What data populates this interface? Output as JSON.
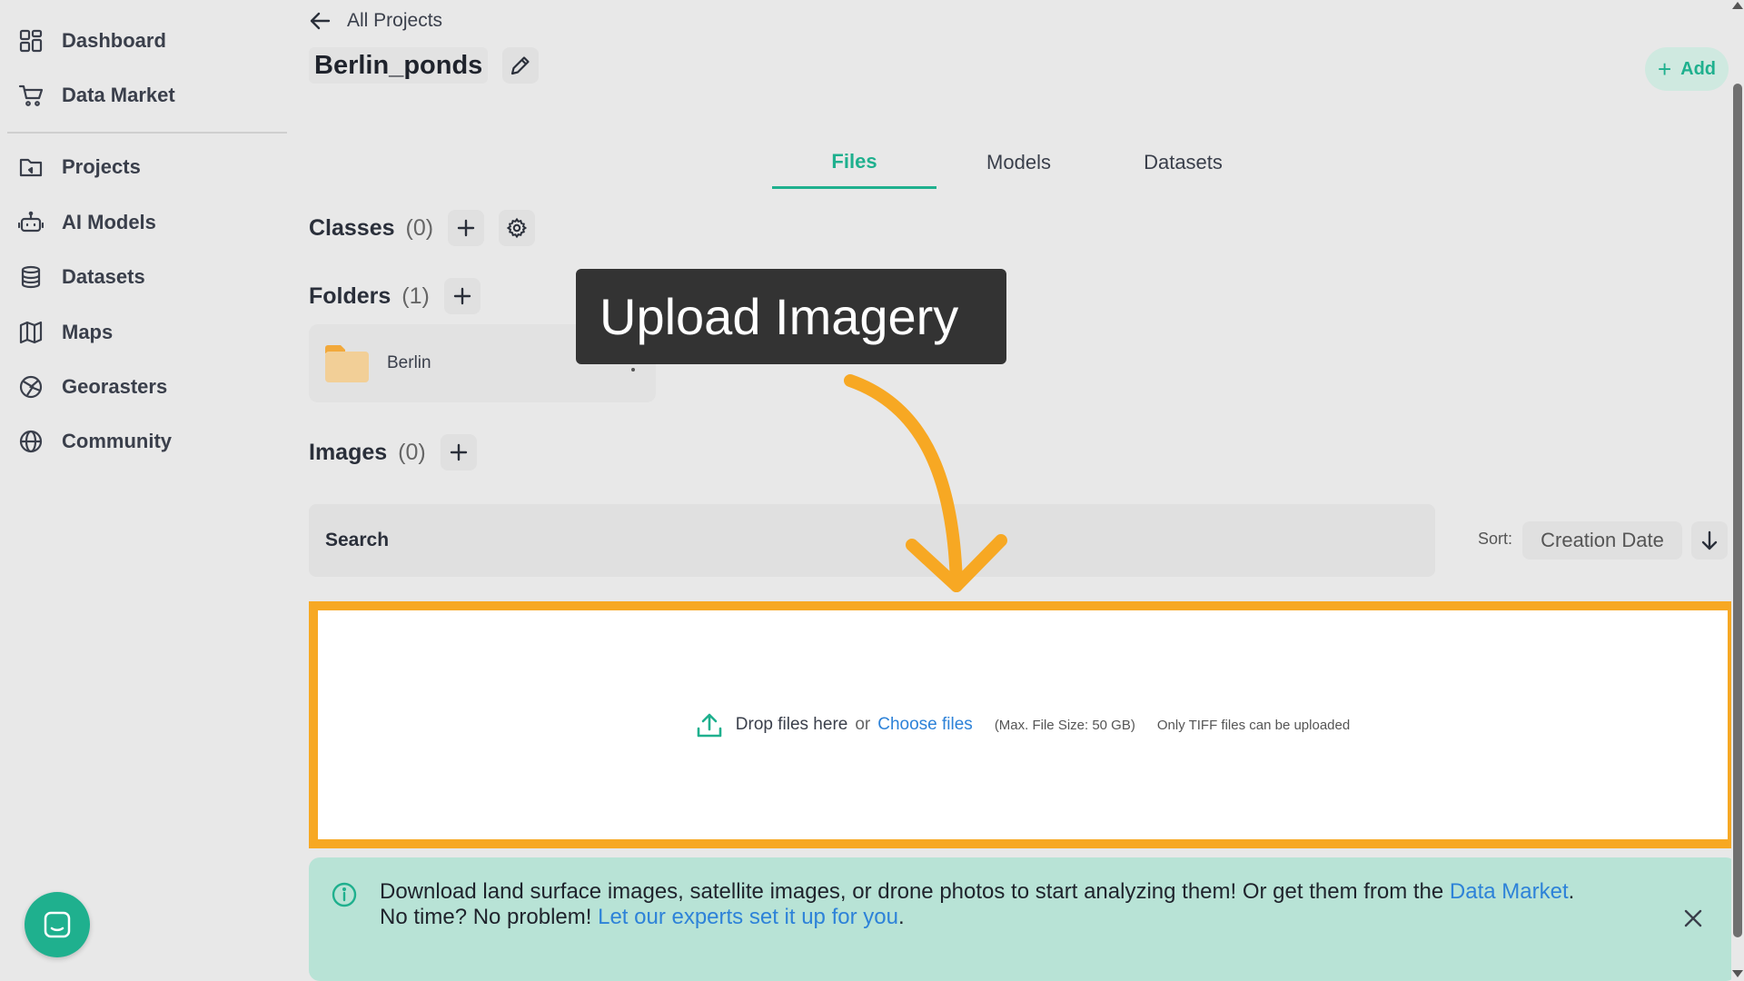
{
  "sidebar": {
    "items": [
      {
        "label": "Dashboard",
        "icon": "dashboard-icon"
      },
      {
        "label": "Data Market",
        "icon": "cart-icon"
      },
      {
        "label": "Projects",
        "icon": "folder-icon"
      },
      {
        "label": "AI Models",
        "icon": "robot-icon"
      },
      {
        "label": "Datasets",
        "icon": "database-icon"
      },
      {
        "label": "Maps",
        "icon": "map-icon"
      },
      {
        "label": "Georasters",
        "icon": "globe-grid-icon"
      },
      {
        "label": "Community",
        "icon": "globe-icon"
      }
    ]
  },
  "header": {
    "back_label": "All Projects",
    "project_name": "Berlin_ponds",
    "add_label": "Add"
  },
  "tabs": [
    {
      "label": "Files",
      "active": true
    },
    {
      "label": "Models",
      "active": false
    },
    {
      "label": "Datasets",
      "active": false
    }
  ],
  "sections": {
    "classes": {
      "label": "Classes",
      "count": "(0)"
    },
    "folders": {
      "label": "Folders",
      "count": "(1)",
      "items": [
        {
          "name": "Berlin"
        }
      ]
    },
    "images": {
      "label": "Images",
      "count": "(0)"
    }
  },
  "callout": {
    "text": "Upload Imagery"
  },
  "search": {
    "placeholder": "Search"
  },
  "sort": {
    "label": "Sort:",
    "value": "Creation Date"
  },
  "dropzone": {
    "drop_text": "Drop files here",
    "or_text": "or",
    "choose_label": "Choose files",
    "max_size": "(Max. File Size: 50 GB)",
    "file_types": "Only TIFF files can be uploaded"
  },
  "banner": {
    "line1": "Download land surface images, satellite images, or drone photos to start analyzing them! Or get them from the ",
    "link1": "Data Market",
    "line1_end": ".",
    "line2": "No time? No problem! ",
    "link2": "Let our experts set it up for you",
    "line2_end": "."
  },
  "colors": {
    "accent": "#1fb08e",
    "highlight": "#f7a823",
    "link": "#2d82d8",
    "banner_bg": "#b8e3d6"
  }
}
